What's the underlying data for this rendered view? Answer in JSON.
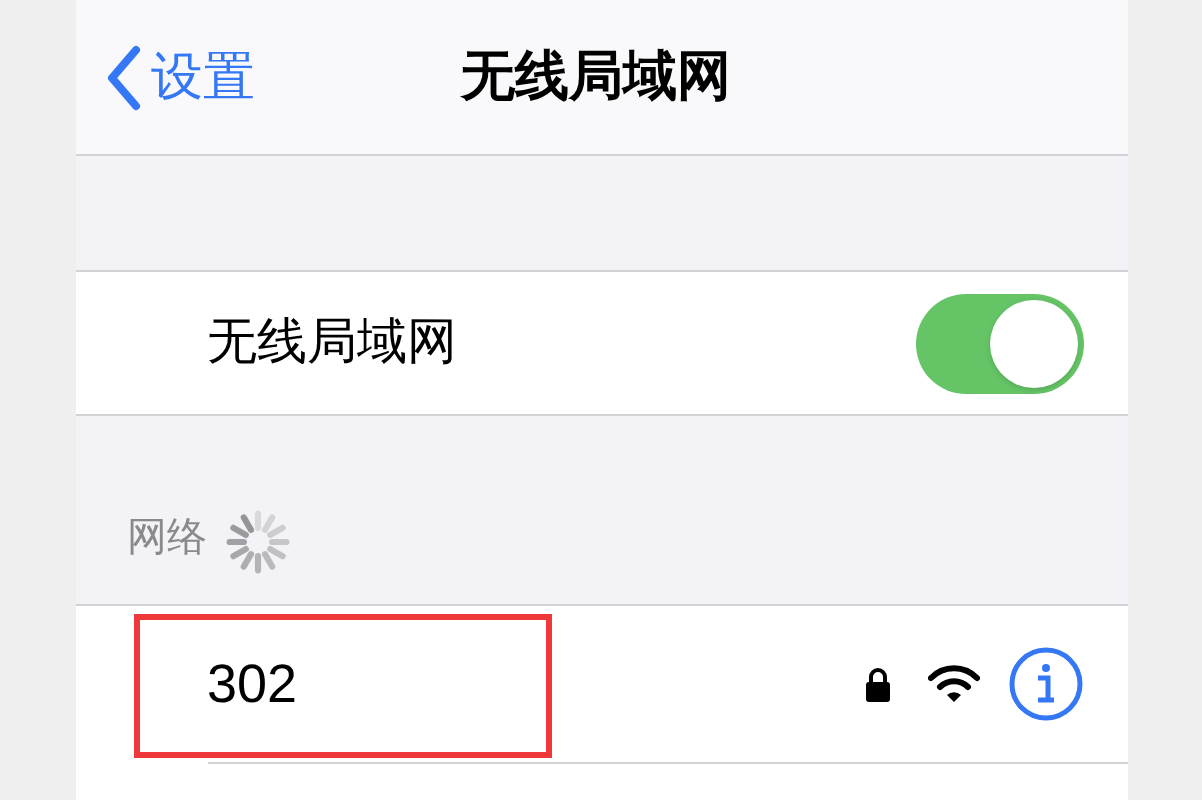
{
  "nav": {
    "back": "设置",
    "title": "无线局域网"
  },
  "wifi_toggle": {
    "label": "无线局域网",
    "on": true
  },
  "networks_header": {
    "label": "网络",
    "loading": true
  },
  "networks": [
    {
      "name": "302",
      "secured": true,
      "highlighted": true
    }
  ]
}
